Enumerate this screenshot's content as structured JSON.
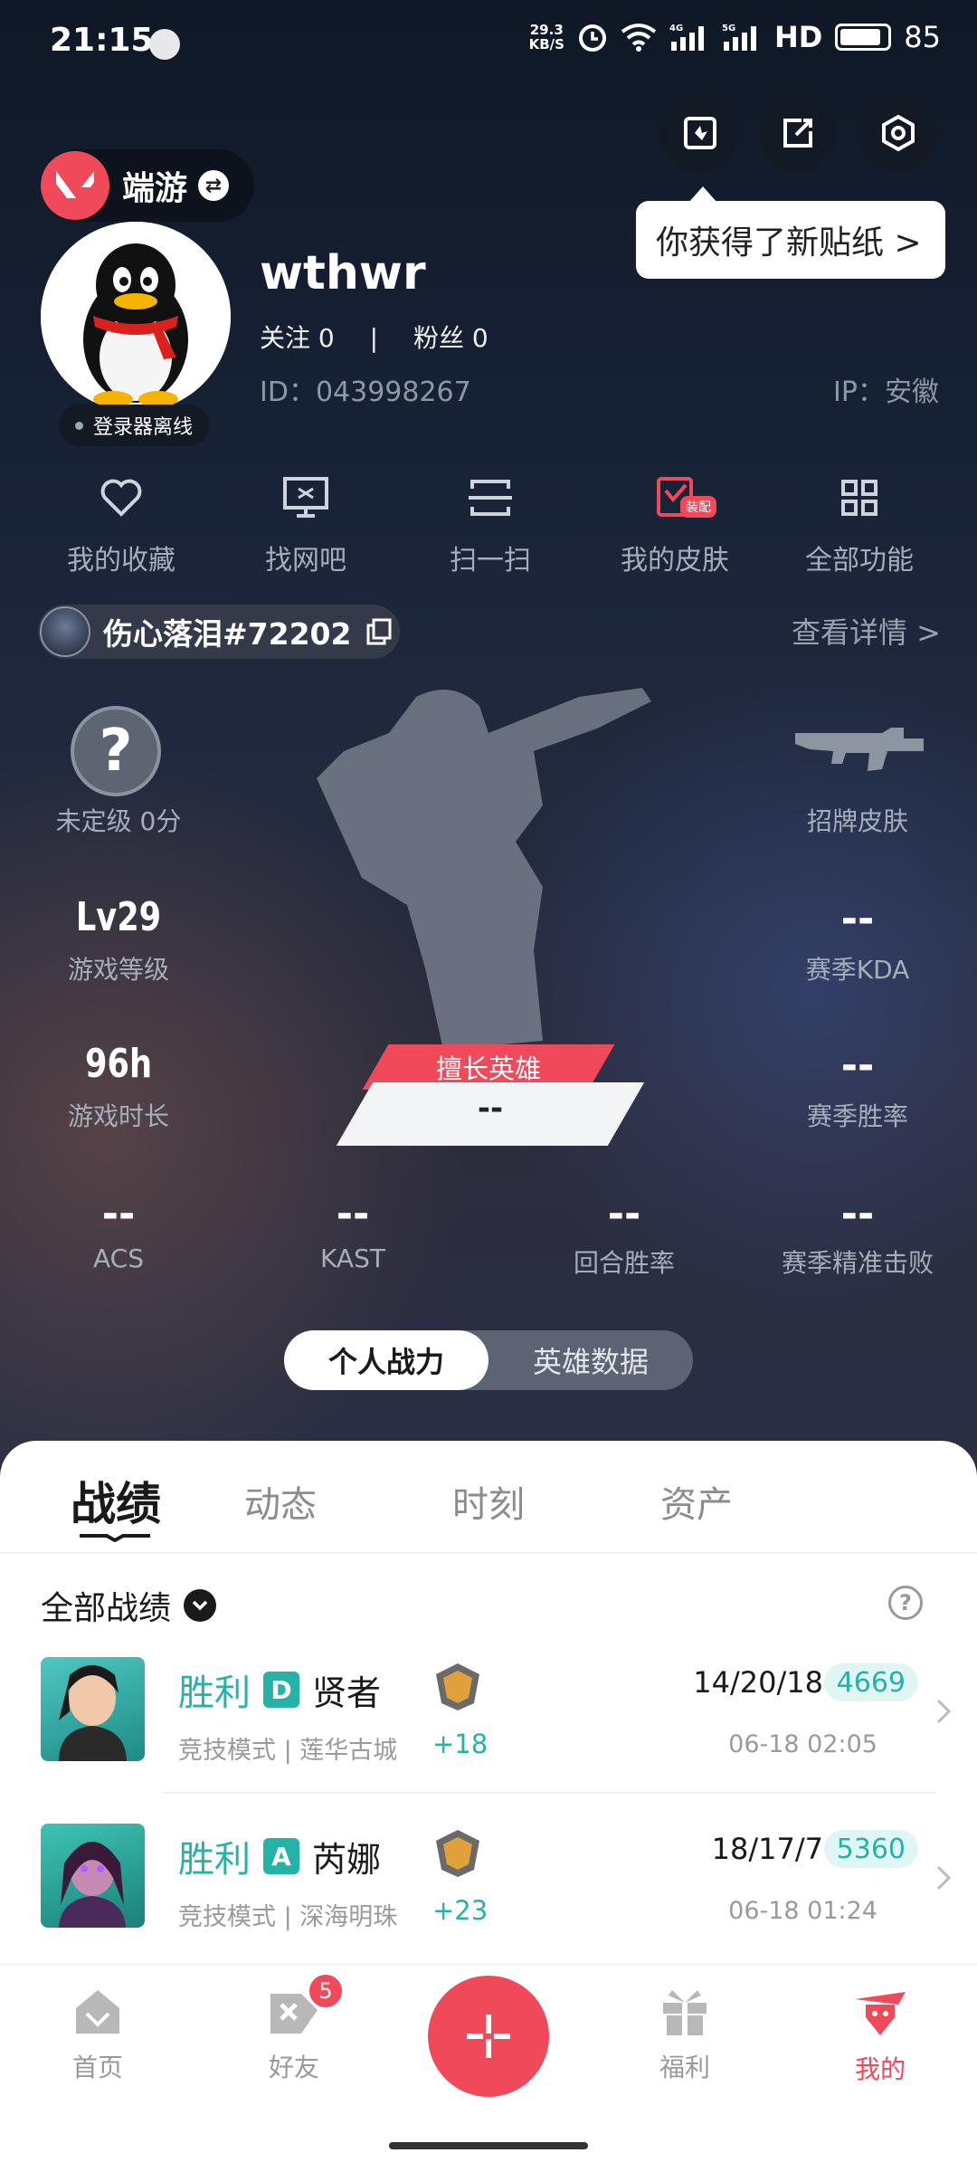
{
  "status_bar": {
    "time": "21:15",
    "net_speed_value": "29.3",
    "net_speed_unit": "KB/S",
    "network": "4G",
    "network2": "5G",
    "hd": "HD",
    "battery": "85"
  },
  "header": {
    "game_name": "端游",
    "sticker_tip": "你获得了新贴纸 >"
  },
  "profile": {
    "username": "wthwr",
    "follow_label": "关注 0",
    "fans_label": "粉丝 0",
    "separator": "|",
    "id_text": "ID：043998267",
    "ip_text": "IP：安徽",
    "status": "登录器离线"
  },
  "quick_actions": [
    {
      "label": "我的收藏"
    },
    {
      "label": "找网吧"
    },
    {
      "label": "扫一扫"
    },
    {
      "label": "我的皮肤",
      "badge": "装配"
    },
    {
      "label": "全部功能"
    }
  ],
  "player": {
    "name": "伤心落泪#72202",
    "details_link": "查看详情 >"
  },
  "stats": {
    "rank_label": "未定级 0分",
    "skin_label": "招牌皮肤",
    "level_value": "Lv29",
    "level_label": "游戏等级",
    "kda_value": "--",
    "kda_label": "赛季KDA",
    "hours_value": "96h",
    "hours_label": "游戏时长",
    "winrate_value": "--",
    "winrate_label": "赛季胜率",
    "best_hero_tag": "擅长英雄",
    "best_hero_value": "--",
    "acs_value": "--",
    "acs_label": "ACS",
    "kast_value": "--",
    "kast_label": "KAST",
    "round_value": "--",
    "round_label": "回合胜率",
    "precise_value": "--",
    "precise_label": "赛季精准击败"
  },
  "toggle": {
    "active": "个人战力",
    "inactive": "英雄数据"
  },
  "tabs": [
    "战绩",
    "动态",
    "时刻",
    "资产"
  ],
  "filter": {
    "label": "全部战绩"
  },
  "matches": [
    {
      "result": "胜利",
      "grade": "D",
      "agent": "贤者",
      "mode": "竞技模式 | 莲华古城",
      "rank_delta": "+18",
      "kda": "14/20/18",
      "acs": "4669",
      "time": "06-18 02:05"
    },
    {
      "result": "胜利",
      "grade": "A",
      "agent": "芮娜",
      "mode": "竞技模式 | 深海明珠",
      "rank_delta": "+23",
      "kda": "18/17/7",
      "acs": "5360",
      "time": "06-18 01:24"
    }
  ],
  "bottom_nav": {
    "home": "首页",
    "friends": "好友",
    "friends_badge": "5",
    "welfare": "福利",
    "me": "我的"
  },
  "colors": {
    "accent": "#f04a5a",
    "win": "#25b3a8"
  }
}
